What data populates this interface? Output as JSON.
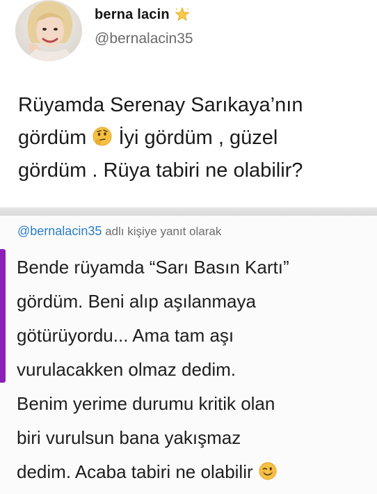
{
  "tweet": {
    "author_name": "berna lacin",
    "author_handle": "@bernalacin35",
    "verified_emoji": "star-emoji",
    "lines": [
      "Rüyamda Serenay Sarıkaya’nın",
      "gördüm",
      "İyi gördüm , güzel",
      "gördüm . Rüya tabiri ne olabilir?"
    ],
    "emoji_1": "thinking-face-emoji"
  },
  "reply": {
    "mention": "@bernalacin35",
    "context_text": " adlı kişiye yanıt olarak",
    "accent_color": "#8c1fb8",
    "lines": [
      "Bende rüyamda “Sarı Basın Kartı”",
      "gördüm. Beni alıp aşılanmaya",
      "götürüyordu... Ama tam aşı",
      "vurulacakken olmaz dedim.",
      "Benim yerime durumu kritik olan",
      "biri vurulsun bana yakışmaz",
      "dedim. Acaba tabiri ne olabilir"
    ],
    "emoji_end": "winking-face-emoji"
  }
}
